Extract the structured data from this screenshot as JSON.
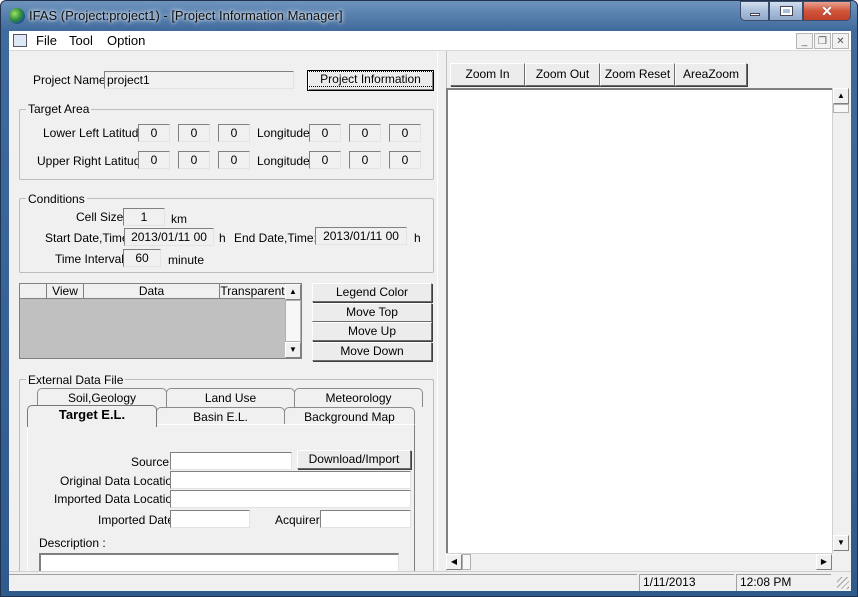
{
  "window": {
    "title": "IFAS (Project:project1) - [Project Information Manager]",
    "caption_buttons": {
      "minimize": "minimize-icon",
      "maximize": "maximize-icon",
      "close": "close-icon"
    }
  },
  "menubar": {
    "items": [
      "File",
      "Tool",
      "Option"
    ],
    "mdi_buttons": {
      "minimize": "_",
      "restore": "❐",
      "close": "✕"
    }
  },
  "project": {
    "name_label": "Project Name:",
    "name_value": "project1",
    "info_button": "Project Information"
  },
  "target_area": {
    "group_label": "Target Area",
    "lower_left_label": "Lower Left Latitude:",
    "upper_right_label": "Upper Right Latitude:",
    "longitude_label": "Longitude:",
    "lower_left_lat": [
      "0",
      "0",
      "0"
    ],
    "lower_left_lon": [
      "0",
      "0",
      "0"
    ],
    "upper_right_lat": [
      "0",
      "0",
      "0"
    ],
    "upper_right_lon": [
      "0",
      "0",
      "0"
    ]
  },
  "conditions": {
    "group_label": "Conditions",
    "cell_size_label": "Cell Size :",
    "cell_size_value": "1",
    "cell_size_unit": "km",
    "start_label": "Start Date,Time:",
    "start_value": "2013/01/11 00",
    "start_unit": "h",
    "end_label": "End Date,Time:",
    "end_value": "2013/01/11 00",
    "end_unit": "h",
    "interval_label": "Time Interval :",
    "interval_value": "60",
    "interval_unit": "minute"
  },
  "layers": {
    "columns": [
      "",
      "View",
      "Data",
      "Transparent"
    ],
    "rows": [],
    "buttons": [
      "Legend Color",
      "Move Top",
      "Move Up",
      "Move Down"
    ]
  },
  "external_data": {
    "group_label": "External Data File",
    "tabs_back": [
      "Soil,Geology",
      "Land Use",
      "Meteorology"
    ],
    "tabs_front": [
      "Target E.L.",
      "Basin E.L.",
      "Background Map"
    ],
    "active_tab": "Target E.L.",
    "source_label": "Source:",
    "source_value": "",
    "download_button": "Download/Import",
    "original_location_label": "Original Data Location:",
    "original_location_value": "",
    "imported_location_label": "Imported Data Location:",
    "imported_location_value": "",
    "imported_date_label": "Imported Date:",
    "imported_date_value": "",
    "acquirer_label": "Acquirer:",
    "acquirer_value": "",
    "description_label": "Description :",
    "description_value": ""
  },
  "map_toolbar": {
    "buttons": [
      "Zoom In",
      "Zoom Out",
      "Zoom Reset",
      "AreaZoom"
    ]
  },
  "statusbar": {
    "date": "1/11/2013",
    "time": "12:08 PM"
  }
}
